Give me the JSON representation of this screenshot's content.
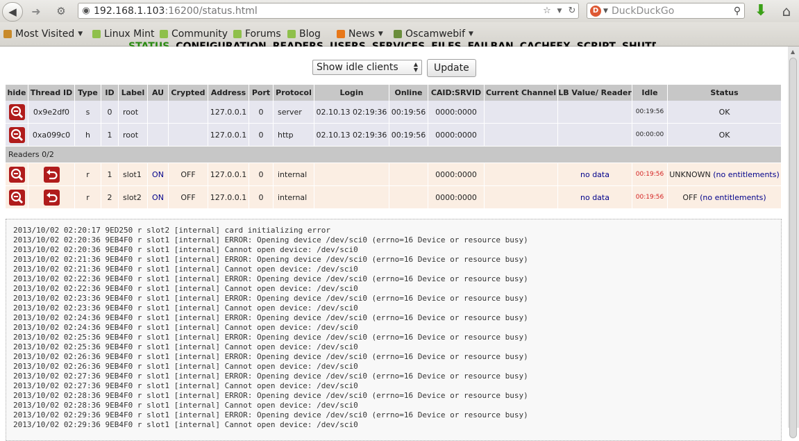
{
  "browser": {
    "url_host": "192.168.1.103",
    "url_path": ":16200/status.html",
    "search_placeholder": "DuckDuckGo",
    "bookmarks": [
      {
        "label": "Most Visited",
        "icon": "folder-icon",
        "dropdown": true
      },
      {
        "label": "Linux Mint",
        "icon": "mint-icon",
        "dropdown": false
      },
      {
        "label": "Community",
        "icon": "mint-icon",
        "dropdown": false
      },
      {
        "label": "Forums",
        "icon": "mint-icon",
        "dropdown": false
      },
      {
        "label": "Blog",
        "icon": "mint-icon",
        "dropdown": false
      },
      {
        "label": "News",
        "icon": "rss-icon",
        "dropdown": true
      },
      {
        "label": "Oscamwebif",
        "icon": "folder-icon",
        "dropdown": true
      }
    ]
  },
  "menu": [
    "STATUS",
    "CONFIGURATION",
    "READERS",
    "USERS",
    "SERVICES",
    "FILES",
    "FAILBAN",
    "CACHEEX",
    "SCRIPT",
    "SHUTDOWN"
  ],
  "controls": {
    "filter_selected": "Show idle clients",
    "update_label": "Update"
  },
  "table": {
    "headers": [
      "hide",
      "Thread ID",
      "Type",
      "ID",
      "Label",
      "AU",
      "Crypted",
      "Address",
      "Port",
      "Protocol",
      "Login",
      "Online",
      "CAID:SRVID",
      "Current Channel",
      "LB Value/ Reader",
      "Idle",
      "Status"
    ],
    "clients": [
      {
        "thread": "0x9e2df0",
        "type": "s",
        "id": "0",
        "label": "root",
        "au": "",
        "crypted": "",
        "address": "127.0.0.1",
        "port": "0",
        "protocol": "server",
        "login": "02.10.13 02:19:36",
        "online": "00:19:56",
        "caid": "0000:0000",
        "channel": "",
        "lb": "",
        "idle": "00:19:56",
        "status": "OK"
      },
      {
        "thread": "0xa099c0",
        "type": "h",
        "id": "1",
        "label": "root",
        "au": "",
        "crypted": "",
        "address": "127.0.0.1",
        "port": "0",
        "protocol": "http",
        "login": "02.10.13 02:19:36",
        "online": "00:19:56",
        "caid": "0000:0000",
        "channel": "",
        "lb": "",
        "idle": "00:00:00",
        "status": "OK"
      }
    ],
    "readers_group_label": "Readers 0/2",
    "readers": [
      {
        "type": "r",
        "id": "1",
        "label": "slot1",
        "au": "ON",
        "crypted": "OFF",
        "address": "127.0.0.1",
        "port": "0",
        "protocol": "internal",
        "login": "",
        "online": "",
        "caid": "0000:0000",
        "channel": "",
        "lb": "no data",
        "idle": "00:19:56",
        "status_main": "UNKNOWN",
        "status_note": "(no entitlements)"
      },
      {
        "type": "r",
        "id": "2",
        "label": "slot2",
        "au": "ON",
        "crypted": "OFF",
        "address": "127.0.0.1",
        "port": "0",
        "protocol": "internal",
        "login": "",
        "online": "",
        "caid": "0000:0000",
        "channel": "",
        "lb": "no data",
        "idle": "00:19:56",
        "status_main": "OFF",
        "status_note": "(no entitlements)"
      }
    ]
  },
  "log": [
    "2013/10/02 02:20:17 9ED250 r slot2 [internal] card initializing error",
    "2013/10/02 02:20:36 9EB4F0 r slot1 [internal] ERROR: Opening device /dev/sci0 (errno=16 Device or resource busy)",
    "2013/10/02 02:20:36 9EB4F0 r slot1 [internal] Cannot open device: /dev/sci0",
    "2013/10/02 02:21:36 9EB4F0 r slot1 [internal] ERROR: Opening device /dev/sci0 (errno=16 Device or resource busy)",
    "2013/10/02 02:21:36 9EB4F0 r slot1 [internal] Cannot open device: /dev/sci0",
    "2013/10/02 02:22:36 9EB4F0 r slot1 [internal] ERROR: Opening device /dev/sci0 (errno=16 Device or resource busy)",
    "2013/10/02 02:22:36 9EB4F0 r slot1 [internal] Cannot open device: /dev/sci0",
    "2013/10/02 02:23:36 9EB4F0 r slot1 [internal] ERROR: Opening device /dev/sci0 (errno=16 Device or resource busy)",
    "2013/10/02 02:23:36 9EB4F0 r slot1 [internal] Cannot open device: /dev/sci0",
    "2013/10/02 02:24:36 9EB4F0 r slot1 [internal] ERROR: Opening device /dev/sci0 (errno=16 Device or resource busy)",
    "2013/10/02 02:24:36 9EB4F0 r slot1 [internal] Cannot open device: /dev/sci0",
    "2013/10/02 02:25:36 9EB4F0 r slot1 [internal] ERROR: Opening device /dev/sci0 (errno=16 Device or resource busy)",
    "2013/10/02 02:25:36 9EB4F0 r slot1 [internal] Cannot open device: /dev/sci0",
    "2013/10/02 02:26:36 9EB4F0 r slot1 [internal] ERROR: Opening device /dev/sci0 (errno=16 Device or resource busy)",
    "2013/10/02 02:26:36 9EB4F0 r slot1 [internal] Cannot open device: /dev/sci0",
    "2013/10/02 02:27:36 9EB4F0 r slot1 [internal] ERROR: Opening device /dev/sci0 (errno=16 Device or resource busy)",
    "2013/10/02 02:27:36 9EB4F0 r slot1 [internal] Cannot open device: /dev/sci0",
    "2013/10/02 02:28:36 9EB4F0 r slot1 [internal] ERROR: Opening device /dev/sci0 (errno=16 Device or resource busy)",
    "2013/10/02 02:28:36 9EB4F0 r slot1 [internal] Cannot open device: /dev/sci0",
    "2013/10/02 02:29:36 9EB4F0 r slot1 [internal] ERROR: Opening device /dev/sci0 (errno=16 Device or resource busy)",
    "2013/10/02 02:29:36 9EB4F0 r slot1 [internal] Cannot open device: /dev/sci0"
  ]
}
